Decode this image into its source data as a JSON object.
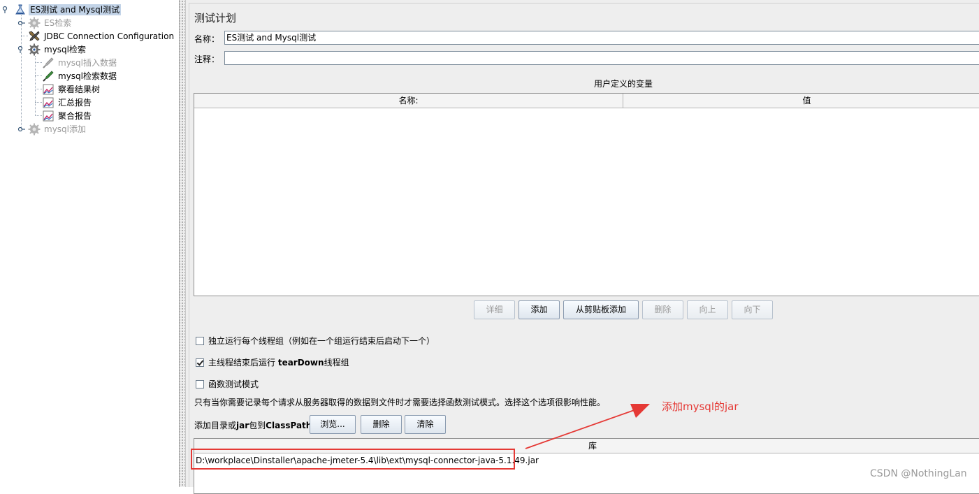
{
  "tree": {
    "items": [
      {
        "label": "ES测试 and Mysql测试",
        "icon": "flask-icon",
        "selected": true,
        "disabled": false
      },
      {
        "label": "ES检索",
        "icon": "gear-icon",
        "selected": false,
        "disabled": true
      },
      {
        "label": "JDBC Connection Configuration",
        "icon": "tools-icon",
        "selected": false,
        "disabled": false
      },
      {
        "label": "mysql检索",
        "icon": "gear-icon",
        "selected": false,
        "disabled": false
      },
      {
        "label": "mysql插入数据",
        "icon": "pipette-icon",
        "selected": false,
        "disabled": true
      },
      {
        "label": "mysql检索数据",
        "icon": "pipette-icon",
        "selected": false,
        "disabled": false
      },
      {
        "label": "察看结果树",
        "icon": "chart-icon",
        "selected": false,
        "disabled": false
      },
      {
        "label": "汇总报告",
        "icon": "chart-icon",
        "selected": false,
        "disabled": false
      },
      {
        "label": "聚合报告",
        "icon": "chart-icon",
        "selected": false,
        "disabled": false
      },
      {
        "label": "mysql添加",
        "icon": "gear-icon",
        "selected": false,
        "disabled": true
      }
    ]
  },
  "panel": {
    "title": "测试计划",
    "name_label": "名称：",
    "name_value": "ES测试 and Mysql测试",
    "comment_label": "注释：",
    "comment_value": "",
    "vars_title": "用户定义的变量",
    "vars_columns": [
      "名称:",
      "值"
    ],
    "buttons": {
      "detail": "详细",
      "add": "添加",
      "paste_add": "从剪贴板添加",
      "delete": "删除",
      "up": "向上",
      "down": "向下"
    },
    "options": {
      "serial": "独立运行每个线程组（例如在一个组运行结束后启动下一个）",
      "teardown_pre": "主线程结束后运行 ",
      "teardown_bold": "tearDown",
      "teardown_post": "线程组",
      "functional": "函数测试模式"
    },
    "note": "只有当你需要记录每个请求从服务器取得的数据到文件时才需要选择函数测试模式。选择这个选项很影响性能。",
    "classpath": {
      "label_pre": "添加目录或",
      "label_mid": "jar",
      "label_mid2": "包到",
      "label_end": "ClassPath",
      "browse": "浏览...",
      "delete": "删除",
      "clear": "清除",
      "column": "库",
      "rows": [
        "D:\\workplace\\Dinstaller\\apache-jmeter-5.4\\lib\\ext\\mysql-connector-java-5.1.49.jar"
      ]
    }
  },
  "annotation": {
    "text": "添加mysql的jar",
    "color": "#e53935"
  },
  "watermark": "CSDN @NothingLan"
}
